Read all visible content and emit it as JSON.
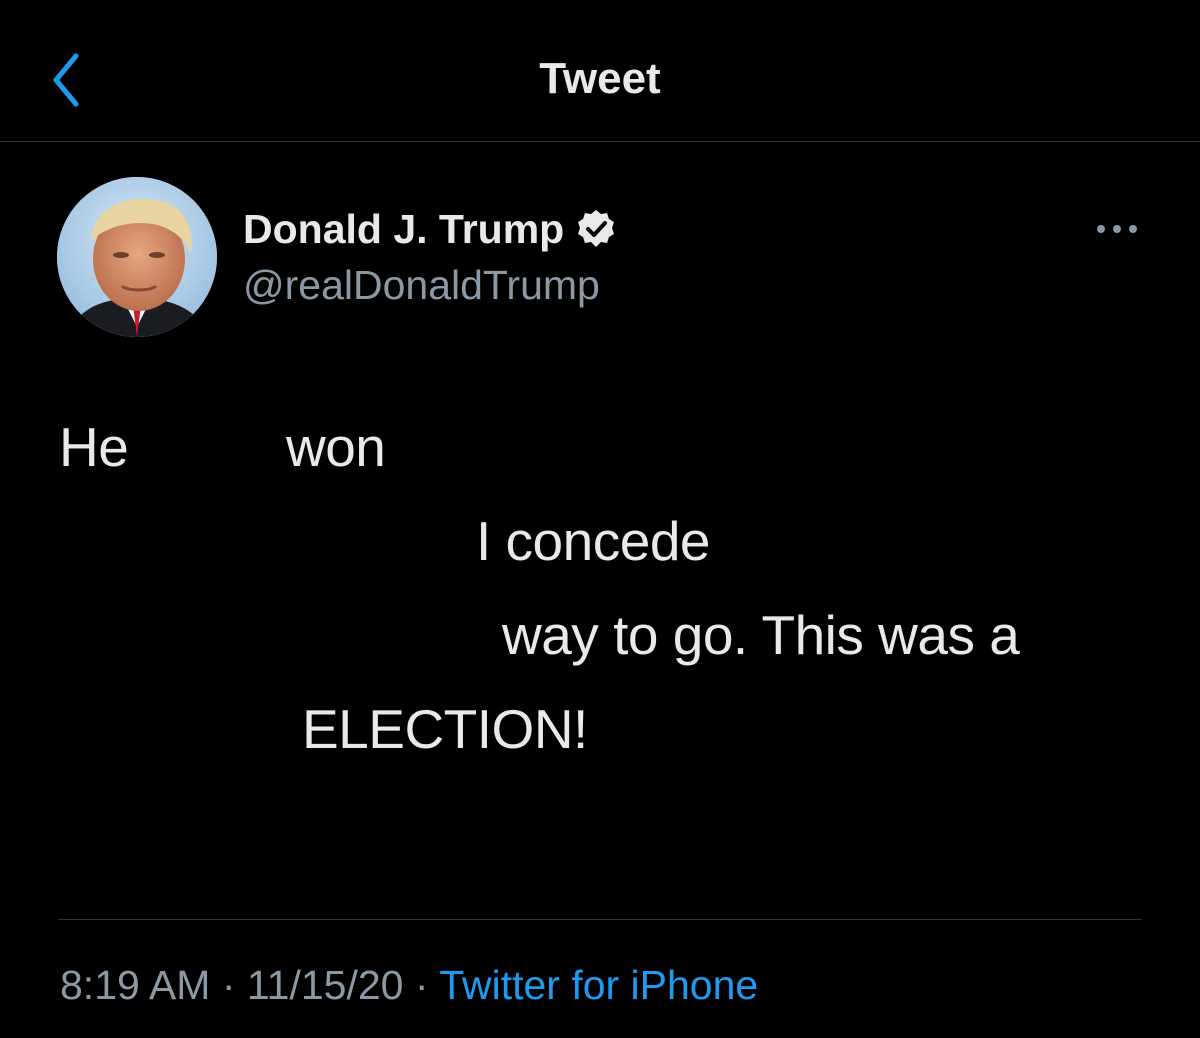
{
  "header": {
    "title": "Tweet",
    "back_icon": "chevron-left-icon"
  },
  "author": {
    "display_name": "Donald J. Trump",
    "handle": "@realDonaldTrump",
    "verified_icon": "verified-badge-icon",
    "avatar": "profile-photo"
  },
  "more_icon": "more-horizontal-icon",
  "tweet": {
    "fragments": [
      "He",
      "won",
      "I concede",
      "way to go. This was a",
      "ELECTION!"
    ]
  },
  "meta": {
    "time": "8:19 AM",
    "separator": "·",
    "date": "11/15/20",
    "source": "Twitter for iPhone"
  },
  "colors": {
    "background": "#000000",
    "text": "#e7e9ea",
    "secondary": "#8b98a5",
    "accent": "#1d9bf0",
    "divider": "#2f3336"
  }
}
